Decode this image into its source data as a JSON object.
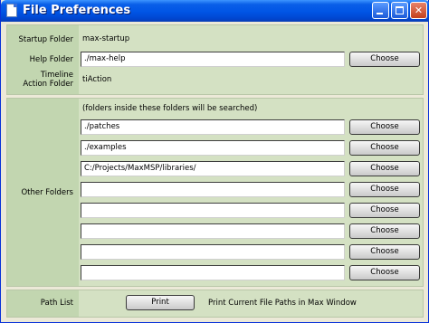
{
  "window": {
    "title": "File Preferences"
  },
  "startup": {
    "label": "Startup Folder",
    "value": "max-startup"
  },
  "help": {
    "label": "Help Folder",
    "value": "./max-help",
    "button": "Choose"
  },
  "timeline": {
    "label_line1": "Timeline",
    "label_line2": "Action Folder",
    "value": "tiAction"
  },
  "other": {
    "label": "Other Folders",
    "note": "(folders inside these folders will be searched)",
    "rows": [
      {
        "value": "./patches",
        "button": "Choose"
      },
      {
        "value": "./examples",
        "button": "Choose"
      },
      {
        "value": "C:/Projects/MaxMSP/libraries/",
        "button": "Choose"
      },
      {
        "value": "",
        "button": "Choose"
      },
      {
        "value": "",
        "button": "Choose"
      },
      {
        "value": "",
        "button": "Choose"
      },
      {
        "value": "",
        "button": "Choose"
      },
      {
        "value": "",
        "button": "Choose"
      }
    ]
  },
  "pathlist": {
    "label": "Path List",
    "button": "Print",
    "description": "Print Current File Paths in Max Window"
  },
  "colors": {
    "panel": "#d4e1c3",
    "label_column": "#c2d6b0",
    "titlebar": "#0055e5"
  }
}
